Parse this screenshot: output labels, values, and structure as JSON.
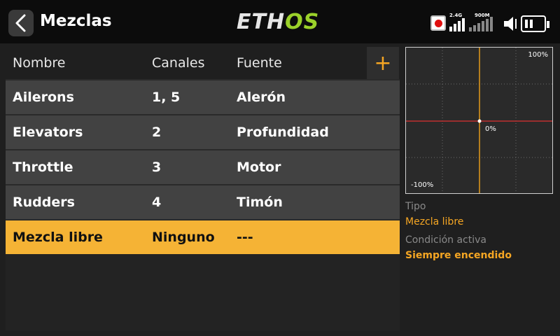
{
  "header": {
    "title": "Mezclas",
    "logo_main": "ETH",
    "logo_accent": "OS",
    "rx1_label": "2.4G",
    "rx2_label": "900M"
  },
  "table": {
    "columns": [
      "Nombre",
      "Canales",
      "Fuente"
    ],
    "add_label": "+",
    "rows": [
      {
        "name": "Ailerons",
        "channels": "1, 5",
        "source": "Alerón"
      },
      {
        "name": "Elevators",
        "channels": "2",
        "source": "Profundidad"
      },
      {
        "name": "Throttle",
        "channels": "3",
        "source": "Motor"
      },
      {
        "name": "Rudders",
        "channels": "4",
        "source": "Timón"
      },
      {
        "name": "Mezcla libre",
        "channels": "Ninguno",
        "source": "---"
      }
    ],
    "selected_index": 4
  },
  "curve": {
    "top_label": "100%",
    "center_label": "0%",
    "bottom_label": "-100%"
  },
  "info": {
    "type_label": "Tipo",
    "type_value": "Mezcla libre",
    "condition_label": "Condición activa",
    "condition_value": "Siempre encendido"
  },
  "colors": {
    "accent": "#f5a623",
    "selected_row": "#f5b335",
    "logo_green": "#9bd12a"
  }
}
